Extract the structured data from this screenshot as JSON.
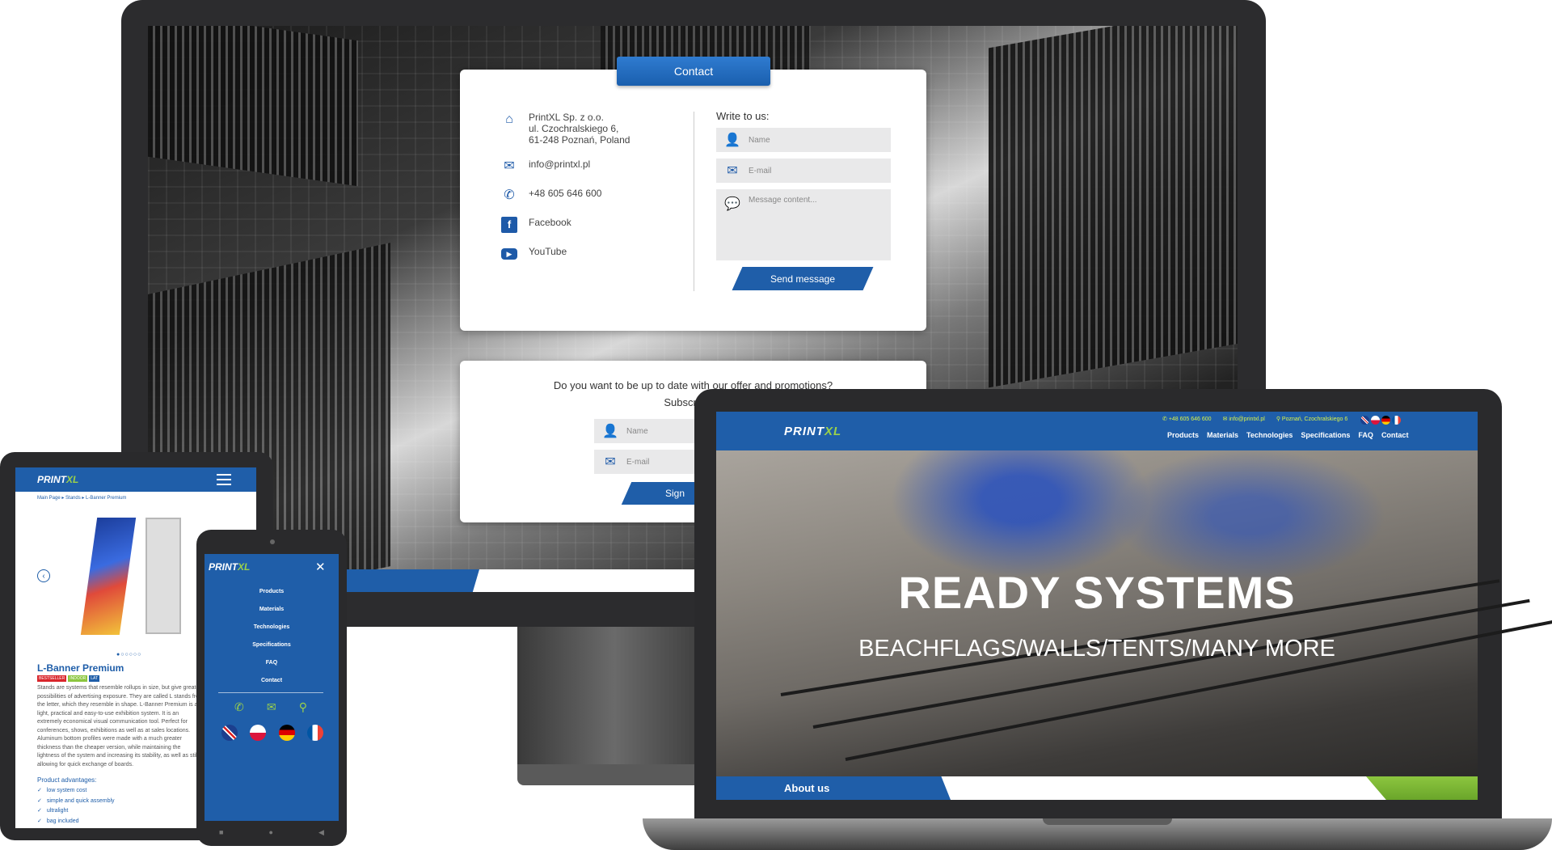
{
  "colors": {
    "brand_blue": "#1f5ea9",
    "accent_green": "#9bd14a",
    "frame": "#2a2a2c"
  },
  "desktop": {
    "contact_tab": "Contact",
    "company": [
      "PrintXL Sp. z o.o.",
      "ul. Czochralskiego 6,",
      "61-248 Poznań, Poland"
    ],
    "email": "info@printxl.pl",
    "phone": "+48 605 646 600",
    "facebook": "Facebook",
    "youtube": "YouTube",
    "write_title": "Write to us:",
    "name_placeholder": "Name",
    "email_placeholder": "E-mail",
    "message_placeholder": "Message content...",
    "send_button": "Send message",
    "newsletter_line1": "Do you want to be up to date with our offer and promotions?",
    "newsletter_line2": "Subscribe to",
    "news_name_placeholder": "Name",
    "news_email_placeholder": "E-mail",
    "news_button": "Sign"
  },
  "laptop": {
    "logo_a": "PRINT",
    "logo_b": "XL",
    "top_phone": "+48 605 646 600",
    "top_email": "info@printxl.pl",
    "top_address": "Poznań, Czochralskiego 6",
    "nav": [
      "Products",
      "Materials",
      "Technologies",
      "Specifications",
      "FAQ",
      "Contact"
    ],
    "hero_title": "READY SYSTEMS",
    "hero_subtitle": "BEACHFLAGS/WALLS/TENTS/MANY MORE",
    "about": "About us"
  },
  "tablet": {
    "logo_a": "PRINT",
    "logo_b": "XL",
    "breadcrumb": "Main Page ▸ Stands ▸ L-Banner Premium",
    "dots": "●○○○○○",
    "product_title": "L-Banner Premium",
    "badges": [
      "BESTSELLER",
      "INDOOR",
      "LAT"
    ],
    "description": "Stands are systems that resemble rollups in size, but give greater possibilities of advertising exposure. They are called L stands from the letter, which they resemble in shape. L-Banner Premium is a light, practical and easy-to-use exhibition system. It is an extremely economical visual communication tool. Perfect for conferences, shows, exhibitions as well as at sales locations. Aluminum bottom profiles were made with a much greater thickness than the cheaper version, while maintaining the lightness of the system and increasing its stability, as well as still allowing for quick exchange of boards.",
    "advantages_title": "Product advantages:",
    "advantages": [
      "low system cost",
      "simple and quick assembly",
      "ultralight",
      "bag included"
    ]
  },
  "phone": {
    "logo_a": "PRINT",
    "logo_b": "XL",
    "menu": [
      "Products",
      "Materials",
      "Technologies",
      "Specifications",
      "FAQ",
      "Contact"
    ]
  }
}
